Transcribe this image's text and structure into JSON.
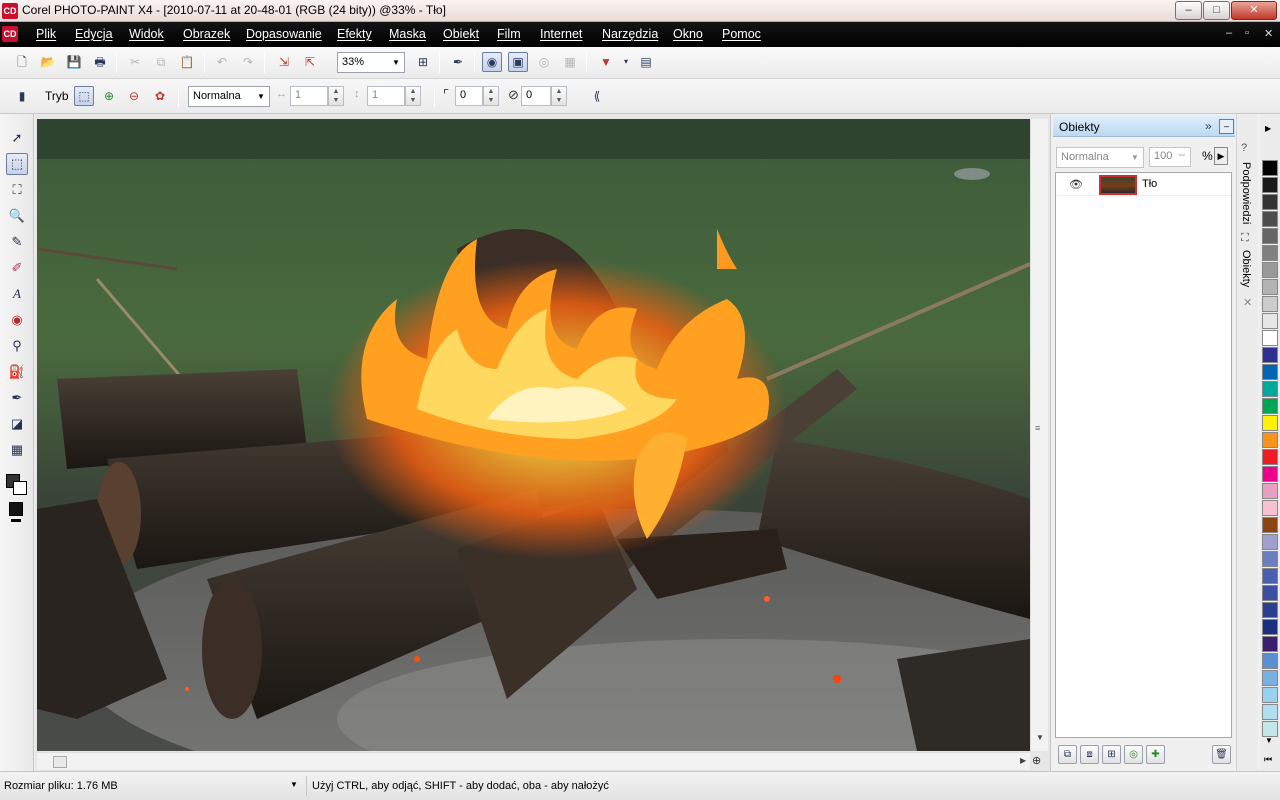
{
  "window": {
    "app_icon": "CD",
    "title": "Corel PHOTO-PAINT X4 - [2010-07-11 at 20-48-01 (RGB (24 bity)) @33% - Tło]",
    "minimize": "–",
    "maximize": "□",
    "close": "✕"
  },
  "menu": {
    "items": [
      "Plik",
      "Edycja",
      "Widok",
      "Obrazek",
      "Dopasowanie",
      "Efekty",
      "Maska",
      "Obiekt",
      "Film",
      "Internet",
      "Narzędzia",
      "Okno",
      "Pomoc"
    ],
    "mdi_minimize": "–",
    "mdi_restore": "▫",
    "mdi_close": "✕"
  },
  "toolbar": {
    "zoom_value": "33%",
    "icons": [
      "new-icon",
      "open-icon",
      "save-icon",
      "print-icon",
      "cut-icon",
      "copy-icon",
      "paste-icon",
      "undo-icon",
      "redo-icon",
      "import-icon",
      "export-icon",
      "zoom-fit-icon",
      "paint-icon",
      "show-mask-icon",
      "show-marquee-icon",
      "launcher-icon",
      "options-icon"
    ]
  },
  "property_bar": {
    "mode_label": "Tryb",
    "merge_mode": "Normalna",
    "width_value": "1",
    "height_value": "1",
    "feather_value": "0",
    "transparency_value": "0"
  },
  "objects_panel": {
    "title": "Obiekty",
    "merge_mode": "Normalna",
    "opacity_value": "100",
    "percent": "%",
    "layers": [
      {
        "name": "Tło",
        "visible": true
      }
    ]
  },
  "docker_tabs": {
    "hints": "Podpowiedzi",
    "objects": "Obiekty"
  },
  "palette": {
    "colors": [
      "#000000",
      "#1a1a1a",
      "#333333",
      "#4d4d4d",
      "#666666",
      "#808080",
      "#999999",
      "#b3b3b3",
      "#cccccc",
      "#e6e6e6",
      "#ffffff",
      "#2e3192",
      "#0066b3",
      "#00a99d",
      "#00a651",
      "#fff200",
      "#f7941d",
      "#ed1c24",
      "#ec008c",
      "#e8a0c0",
      "#f9c0d0",
      "#8b4513",
      "#a0a0d0",
      "#6b7fc0",
      "#4a5fb0",
      "#3a4fa0",
      "#2a3f90",
      "#1a2f80",
      "#3b1f6e",
      "#5a8fd0",
      "#7ab0e0",
      "#9ad0f0",
      "#b0e0f0",
      "#c0e8e8"
    ]
  },
  "status": {
    "file_size": "Rozmiar pliku: 1.76 MB",
    "hint": "Użyj CTRL, aby odjąć, SHIFT - aby dodać, oba - aby nałożyć"
  }
}
